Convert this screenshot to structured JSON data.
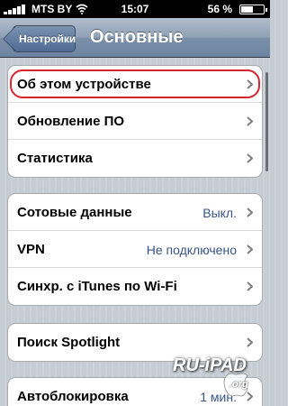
{
  "status_bar": {
    "carrier": "MTS BY",
    "time": "15:07",
    "battery_percent_label": "56 %",
    "battery_level": 0.56
  },
  "nav": {
    "back_label": "Настройки",
    "title": "Основные"
  },
  "groups": [
    {
      "cells": [
        {
          "label": "Об этом устройстве",
          "value": "",
          "highlighted": true
        },
        {
          "label": "Обновление ПО",
          "value": ""
        },
        {
          "label": "Статистика",
          "value": ""
        }
      ]
    },
    {
      "cells": [
        {
          "label": "Сотовые данные",
          "value": "Выкл."
        },
        {
          "label": "VPN",
          "value": "Не подключено"
        },
        {
          "label": "Синхр. с iTunes по Wi-Fi",
          "value": ""
        }
      ]
    },
    {
      "cells": [
        {
          "label": "Поиск Spotlight",
          "value": ""
        }
      ]
    },
    {
      "cells": [
        {
          "label": "Автоблокировка",
          "value": "1 мин."
        }
      ]
    }
  ],
  "watermark": {
    "text": "RU-iPAD",
    "suffix": ".org"
  },
  "colors": {
    "value_text": "#385487",
    "highlight_ring": "#d9232e",
    "nav_bar": "#6d84a2"
  },
  "icons": {
    "chevron": "chevron-right-icon",
    "signal": "signal-bars-icon",
    "wifi": "wifi-icon",
    "battery": "battery-icon"
  }
}
